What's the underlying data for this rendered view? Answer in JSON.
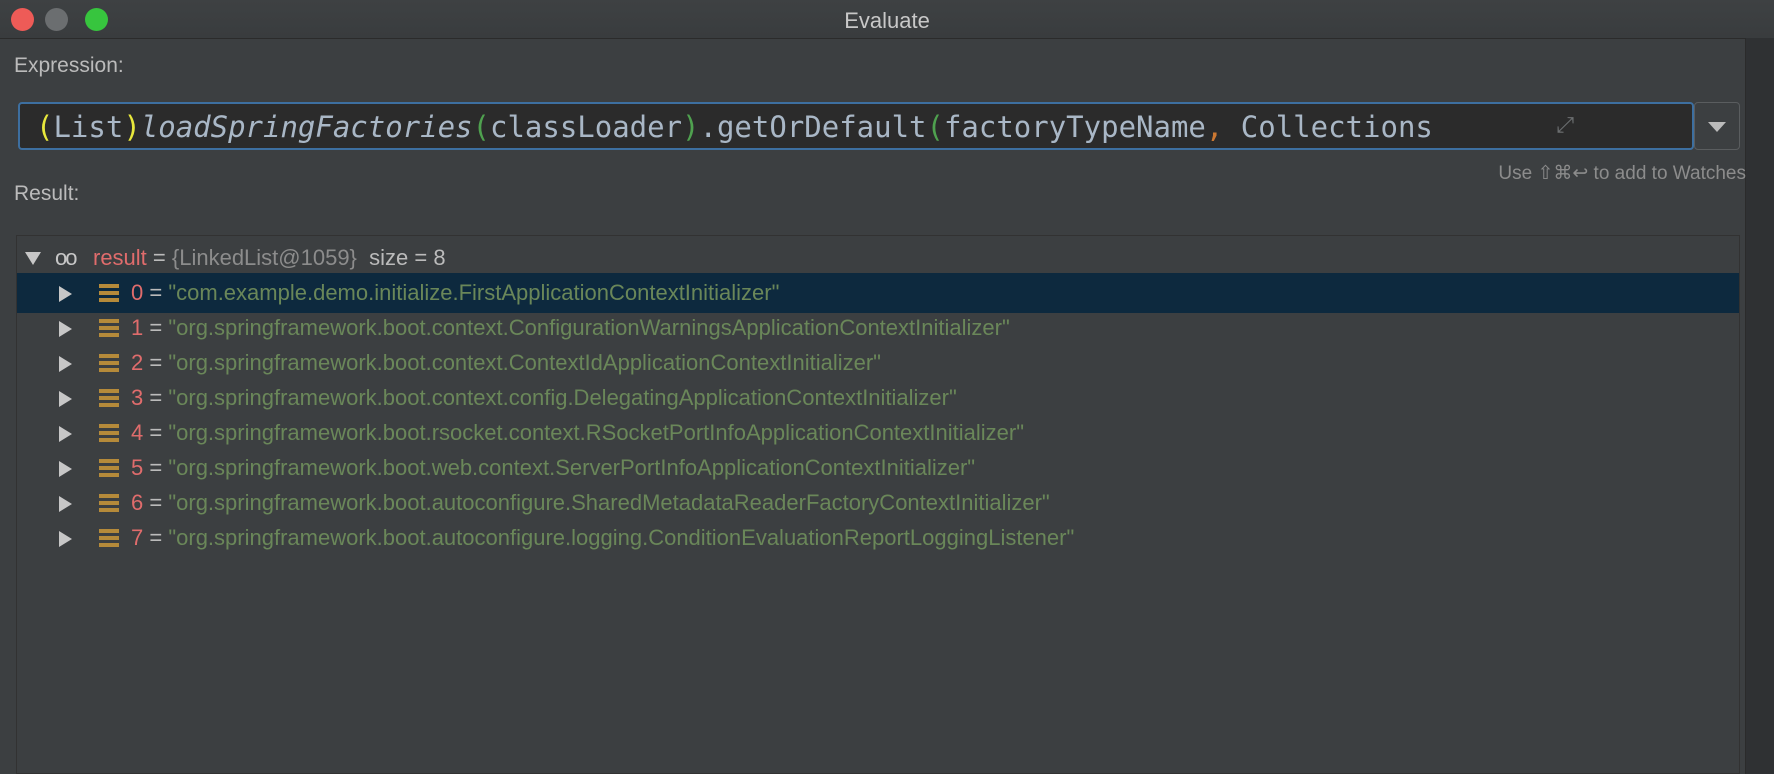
{
  "window": {
    "title": "Evaluate"
  },
  "expression": {
    "label": "Expression:",
    "parts": {
      "open_paren": "(",
      "cast_type": "List",
      "close_paren": ")",
      "method": "loadSpringFactories",
      "arg_open": "(",
      "arg": "classLoader",
      "arg_close": ")",
      "call": ".getOrDefault",
      "call_open": "(",
      "param1": "factoryTypeName",
      "comma": ",",
      "param2": " Collections"
    },
    "hint": "Use ⇧⌘↩ to add to Watches"
  },
  "result": {
    "label": "Result:",
    "root": {
      "name": "result",
      "eq": " = ",
      "type": "{LinkedList@1059}",
      "size": "size = 8"
    },
    "items": [
      {
        "index": "0",
        "value": "\"com.example.demo.initialize.FirstApplicationContextInitializer\""
      },
      {
        "index": "1",
        "value": "\"org.springframework.boot.context.ConfigurationWarningsApplicationContextInitializer\""
      },
      {
        "index": "2",
        "value": "\"org.springframework.boot.context.ContextIdApplicationContextInitializer\""
      },
      {
        "index": "3",
        "value": "\"org.springframework.boot.context.config.DelegatingApplicationContextInitializer\""
      },
      {
        "index": "4",
        "value": "\"org.springframework.boot.rsocket.context.RSocketPortInfoApplicationContextInitializer\""
      },
      {
        "index": "5",
        "value": "\"org.springframework.boot.web.context.ServerPortInfoApplicationContextInitializer\""
      },
      {
        "index": "6",
        "value": "\"org.springframework.boot.autoconfigure.SharedMetadataReaderFactoryContextInitializer\""
      },
      {
        "index": "7",
        "value": "\"org.springframework.boot.autoconfigure.logging.ConditionEvaluationReportLoggingListener\""
      }
    ],
    "eq": " = "
  },
  "colors": {
    "background": "#3c3f41",
    "selection": "#0d293e",
    "name": "#e06c6c",
    "string": "#6a8759",
    "focus_border": "#3d6fa0"
  },
  "icons": {
    "root_toggle": "chevron-down-icon",
    "root_icon": "glasses-icon",
    "item_toggle": "chevron-right-icon",
    "item_icon": "list-item-icon"
  }
}
